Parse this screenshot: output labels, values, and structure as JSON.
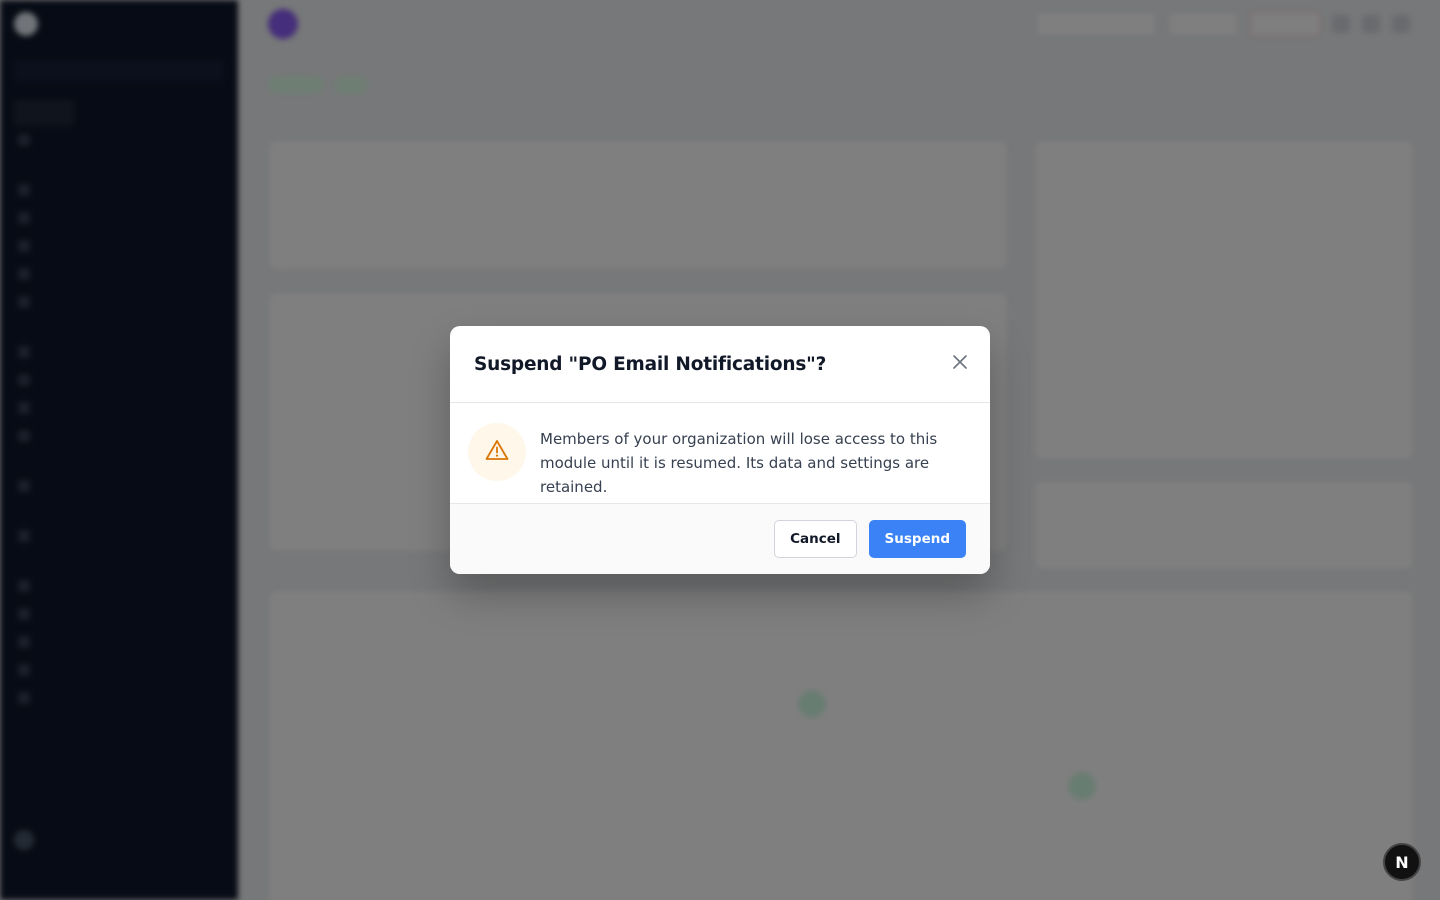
{
  "modal": {
    "title": "Suspend \"PO Email Notifications\"?",
    "message": "Members of your organization will lose access to this module until it is resumed. Its data and settings are retained.",
    "cancel_label": "Cancel",
    "confirm_label": "Suspend",
    "icons": {
      "close": "close-icon",
      "warning": "warning-triangle-icon"
    }
  },
  "dev_badge": {
    "label": "N"
  },
  "colors": {
    "primary": "#3b82f6",
    "warning": "#d97706",
    "sidebar": "#0f172a",
    "overlay": "rgba(0,0,0,0.5)"
  }
}
